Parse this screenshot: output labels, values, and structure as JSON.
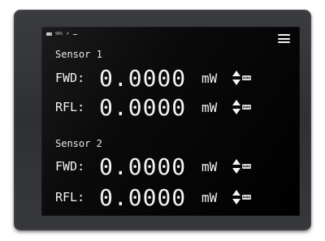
{
  "status": {
    "battery_icon": "battery-icon",
    "battery_text": "96%",
    "usb_icon": "usb-icon",
    "signal_icon": "dash-icon"
  },
  "menu_icon": "hamburger-menu-icon",
  "sensors": [
    {
      "title": "Sensor 1",
      "fwd": {
        "label": "FWD:",
        "value": "0.0000",
        "unit": "mW",
        "auto": "Auto"
      },
      "rfl": {
        "label": "RFL:",
        "value": "0.0000",
        "unit": "mW",
        "auto": "Auto"
      }
    },
    {
      "title": "Sensor 2",
      "fwd": {
        "label": "FWD:",
        "value": "0.0000",
        "unit": "mW",
        "auto": "Auto"
      },
      "rfl": {
        "label": "RFL:",
        "value": "0.0000",
        "unit": "mW",
        "auto": "Auto"
      }
    }
  ],
  "colors": {
    "screen_bg": "#000000",
    "text": "#f4f4f4",
    "bezel": "#333539"
  }
}
